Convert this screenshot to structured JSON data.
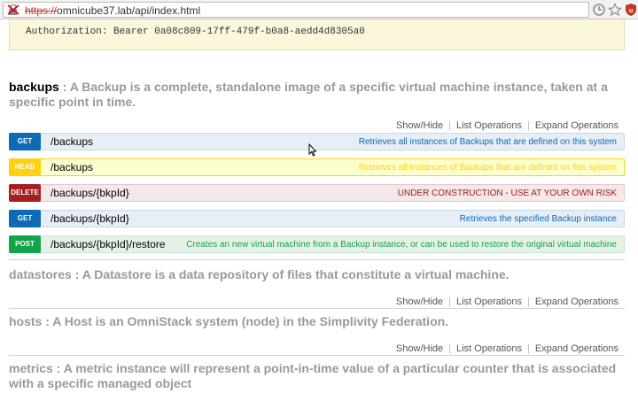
{
  "browser": {
    "url_scheme": "https://",
    "url_rest": "omnicube37.lab/api/index.html",
    "icons": [
      "lock-broken-icon",
      "reader-icon",
      "star-icon",
      "extension-shield-icon"
    ]
  },
  "auth": {
    "text": "Authorization: Bearer 0a08c809-17ff-479f-b0a8-aedd4d8305a0"
  },
  "resources": {
    "backups": {
      "name": "backups",
      "desc": " : A Backup is a complete, standalone image of a specific virtual machine instance, taken at a specific point in time.",
      "links": {
        "show_hide": "Show/Hide",
        "list_ops": "List Operations",
        "expand_ops": "Expand Operations"
      },
      "ops": [
        {
          "method": "GET",
          "path": "/backups",
          "summary": "Retrieves all instances of Backups that are defined on this system"
        },
        {
          "method": "HEAD",
          "path": "/backups",
          "summary": "Retrieves all instances of Backups that are defined on this system"
        },
        {
          "method": "DELETE",
          "path": "/backups/{bkpId}",
          "summary": "UNDER CONSTRUCTION - USE AT YOUR OWN RISK"
        },
        {
          "method": "GET",
          "path": "/backups/{bkpId}",
          "summary": "Retrieves the specified Backup instance"
        },
        {
          "method": "POST",
          "path": "/backups/{bkpId}/restore",
          "summary": "Creates an new virtual machine from a Backup instance, or can be used to restore the original virtual machine"
        }
      ]
    },
    "datastores": {
      "title": "datastores : A Datastore is a data repository of files that constitute a virtual machine.",
      "links": {
        "show_hide": "Show/Hide",
        "list_ops": "List Operations",
        "expand_ops": "Expand Operations"
      }
    },
    "hosts": {
      "title": "hosts : A Host is an OmniStack system (node) in the Simplivity Federation.",
      "links": {
        "show_hide": "Show/Hide",
        "list_ops": "List Operations",
        "expand_ops": "Expand Operations"
      }
    },
    "metrics": {
      "title": "metrics : A metric instance will represent a point-in-time value of a particular counter that is associated with a specific managed object"
    }
  },
  "colors": {
    "get": "#0f6ab4",
    "head": "#ffd20f",
    "delete": "#a41e22",
    "post": "#10a54a",
    "auth_bg": "#fcf6db"
  }
}
